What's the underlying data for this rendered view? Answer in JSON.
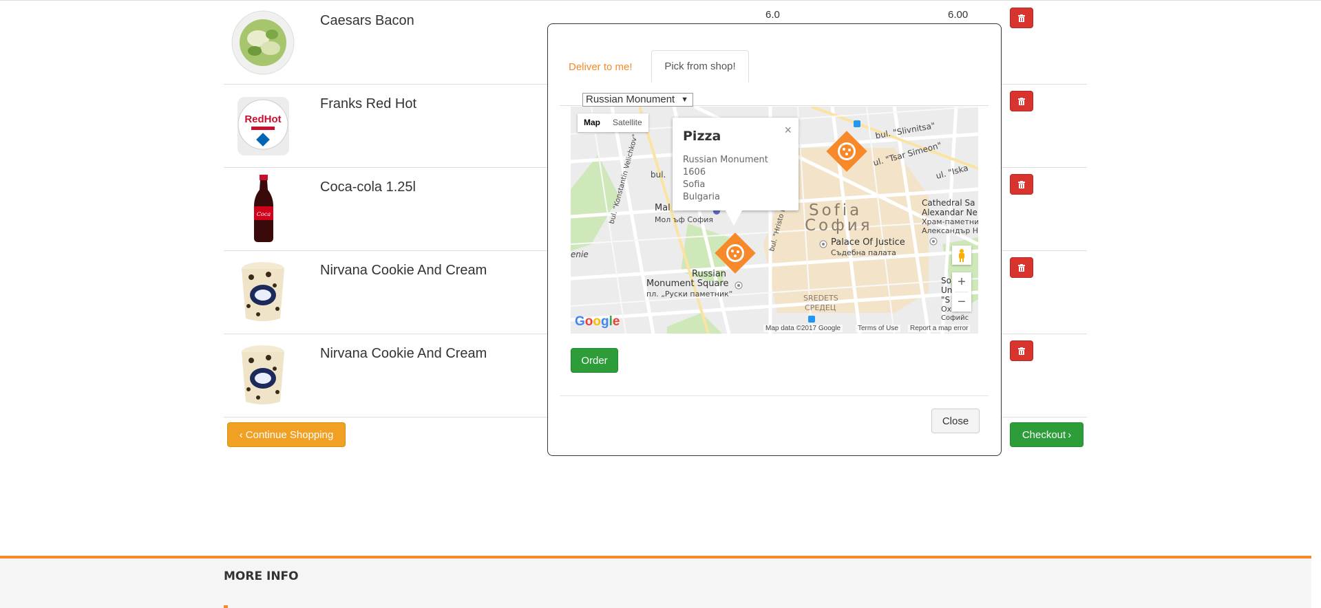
{
  "cart": {
    "items": [
      {
        "name": "Caesars Bacon",
        "qty": "6.0",
        "price": "6.00",
        "image": "salad-image"
      },
      {
        "name": "Franks Red Hot",
        "image": "sauce-image"
      },
      {
        "name": "Coca-cola 1.25l",
        "image": "cola-bottle-image"
      },
      {
        "name": "Nirvana Cookie And Cream",
        "image": "ice-cream-image"
      },
      {
        "name": "Nirvana Cookie And Cream",
        "image": "ice-cream-image"
      }
    ],
    "delete_icon": "trash-icon",
    "continue_label": "Continue Shopping",
    "checkout_label": "Checkout"
  },
  "modal": {
    "tabs": {
      "deliver": "Deliver to me!",
      "pick": "Pick from shop!"
    },
    "shop_select": "Russian Monument",
    "map": {
      "type_map": "Map",
      "type_satellite": "Satellite",
      "info_title": "Pizza",
      "info_lines": [
        "Russian Monument",
        "1606",
        "Sofia",
        "Bulgaria"
      ],
      "city_latin": "Sofia",
      "city_cyrillic": "София",
      "labels": {
        "russian_monument_1": "Russian",
        "russian_monument_2": "Monument Square",
        "russian_monument_bg": "пл. „Руски паметник“",
        "palace": "Palace Of Justice",
        "palace_bg": "Съдебна палата",
        "cathedral_1": "Cathedral Sa",
        "cathedral_2": "Alexandar Ne",
        "cathedral_3": "Храм-паметни",
        "cathedral_4": "Александър Н",
        "sredets": "SREDETS",
        "sredets_bg": "СРЕДЕЦ",
        "slivnitsa": "bul. \"Slivnitsa\"",
        "tsar_simeon": "ul. \"Tsar Simeon\"",
        "iskar": "ul. \"Iska",
        "hristo_botev": "bul. \"Hristo Botev\"",
        "konstantin": "bul. \"Konstantin Velichkov\"",
        "mall": "Mal",
        "mall_bg": "Мол ъф София",
        "uni_1": "So",
        "uni_2": "Uni",
        "uni_3": "\"S",
        "uni_4": "Ох",
        "uni_5": "Софийс",
        "bul_left": "bul.",
        "enie": "enie"
      },
      "attribution": "Map data ©2017 Google",
      "terms": "Terms of Use",
      "report": "Report a map error",
      "google": "Google",
      "zoom_in": "+",
      "zoom_out": "−"
    },
    "order_label": "Order",
    "close_label": "Close"
  },
  "footer": {
    "title": "MORE INFO"
  },
  "colors": {
    "accent": "#f7892a",
    "danger": "#d9332e",
    "success": "#2d9d3a"
  }
}
